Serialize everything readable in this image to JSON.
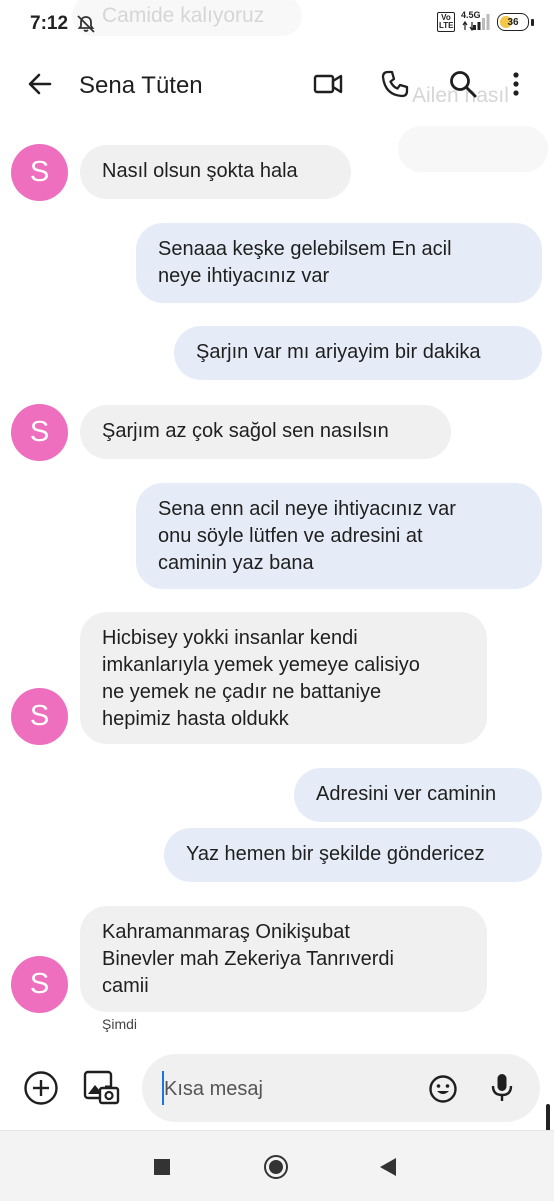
{
  "status_bar": {
    "time": "7:12",
    "network": "4.5G",
    "volte": "Vo LTE",
    "battery": "36"
  },
  "background_notification": {
    "top_text": "Camide kalıyoruz",
    "header_text": "Ailen nasıl"
  },
  "app_bar": {
    "contact_name": "Sena Tüten",
    "icons": [
      "back-arrow-icon",
      "video-call-icon",
      "phone-icon",
      "search-icon",
      "more-vert-icon"
    ]
  },
  "avatar_letter": "S",
  "messages": [
    {
      "direction": "incoming",
      "text": "Nasıl olsun şokta hala"
    },
    {
      "direction": "outgoing",
      "text": "Senaaa keşke gelebilsem En acil\nneye ihtiyacınız var"
    },
    {
      "direction": "outgoing",
      "text": "Şarjın var mı ariyayim bir dakika"
    },
    {
      "direction": "incoming",
      "text": "Şarjım az çok sağol sen nasılsın"
    },
    {
      "direction": "outgoing",
      "text": "Sena enn acil neye ihtiyacınız var\nonu söyle lütfen ve adresini at\ncaminin yaz bana"
    },
    {
      "direction": "incoming",
      "text": "Hicbisey yokki insanlar kendi\nimkanlarıyla yemek yemeye calisiyo\nne yemek ne çadır ne  battaniye\nhepimiz hasta oldukk"
    },
    {
      "direction": "outgoing",
      "text": "Adresini ver caminin"
    },
    {
      "direction": "outgoing",
      "text": "Yaz hemen bir şekilde göndericez"
    },
    {
      "direction": "incoming",
      "text": "Kahramanmaraş Onikişubat\nBinevler mah Zekeriya Tanrıverdi\ncamii"
    }
  ],
  "last_message_time": "Şimdi",
  "composer": {
    "placeholder": "Kısa mesaj",
    "icons": [
      "add-icon",
      "gallery-icon",
      "emoji-icon",
      "mic-icon"
    ]
  },
  "colors": {
    "avatar": "#ed6fbd",
    "incoming_bubble": "#f0f0f0",
    "outgoing_bubble": "#e6ecf7"
  }
}
